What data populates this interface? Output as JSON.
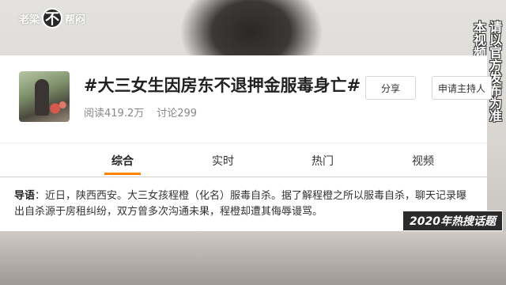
{
  "watermark": {
    "left": "老梁",
    "badge": "不",
    "right": "帮闷"
  },
  "caption": {
    "col1": "请以官方发布为准",
    "col2": "本视频为个人观点"
  },
  "topic": {
    "title": "#大三女生因房东不退押金服毒身亡#",
    "reads": "阅读419.2万",
    "discussions": "讨论299"
  },
  "buttons": {
    "share": "分享",
    "apply_host": "申请主持人"
  },
  "tabs": [
    "综合",
    "实时",
    "热门",
    "视频"
  ],
  "lead": {
    "label": "导语",
    "text": "：近日，陕西西安。大三女孩程橙（化名）服毒自杀。据了解程橙之所以服毒自杀，聊天记录曝出自杀源于房租纠纷，双方曾多次沟通未果，程橙却遭其侮辱谩骂。"
  },
  "badge_hot": "2020年热搜话题",
  "colors": {
    "accent": "#ff8200",
    "card": "#ffffff"
  }
}
